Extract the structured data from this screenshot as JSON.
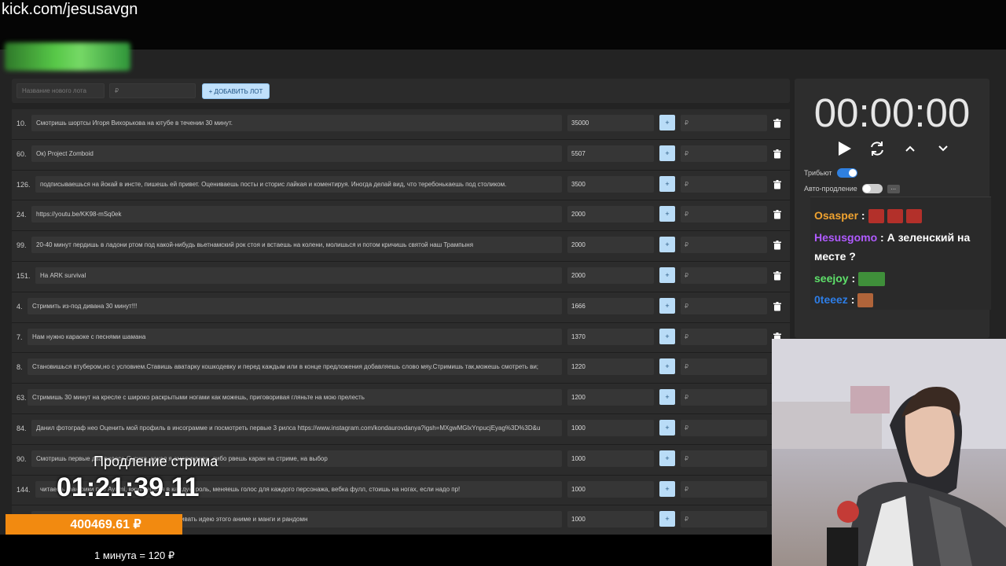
{
  "stream_url": "kick.com/jesusavgn",
  "add_lot": {
    "name_placeholder": "Название нового лота",
    "amount_placeholder": "₽",
    "button_label": "+ ДОБАВИТЬ ЛОТ"
  },
  "lots": [
    {
      "num": "10.",
      "name": "Смотришь шортсы Игоря Вихорькова на ютубе в течении 30 минут.",
      "amount": "35000"
    },
    {
      "num": "60.",
      "name": "Ок) Project Zomboid",
      "amount": "5507"
    },
    {
      "num": "126.",
      "name": "подписываешься на йокай в инсте, пишешь ей привет. Оцениваешь посты и сторис лайкая и коментируя. Иногда делай вид, что теребонькаешь под столиком.",
      "amount": "3500"
    },
    {
      "num": "24.",
      "name": "https://youtu.be/KK98-mSq0ek",
      "amount": "2000"
    },
    {
      "num": "99.",
      "name": "20-40 минут пердишь в ладони ртом под какой-нибудь вьетнамский рок стоя и встаешь на колени, молишься и потом кричишь святой наш Трампыня",
      "amount": "2000"
    },
    {
      "num": "151.",
      "name": "На ARK survival",
      "amount": "2000"
    },
    {
      "num": "4.",
      "name": "Стримить из-под дивана 30 минут!!!",
      "amount": "1666"
    },
    {
      "num": "7.",
      "name": "Нам нужно караоке с песнями шамана",
      "amount": "1370"
    },
    {
      "num": "8.",
      "name": "Становишься втубером,но с условием.Ставишь аватарку кошкодевку и перед каждым или в конце предложения добавляешь слово мяу.Стримишь так,можешь смотреть ви;",
      "amount": "1220"
    },
    {
      "num": "63.",
      "name": "Стримишь 30 минут на кресле с широко раскрытыми ногами как можешь, приговоривая гляньте на мою прелесть",
      "amount": "1200"
    },
    {
      "num": "84.",
      "name": "Данил фотограф нео Оценить мой профиль в инсограмме и посмотреть первые 3 рилса https://www.instagram.com/kondaurovdanya?igsh=MXgwMGlxYnpucjEyag%3D%3D&u",
      "amount": "1000"
    },
    {
      "num": "90.",
      "name": "Смотришь первые два видоса Сусика, какая я американец, либо рвешь каран на стриме, на выбор",
      "amount": "1000"
    },
    {
      "num": "144.",
      "name": "читаешь фанфики про Ayumi, вживаешься в каждую роль, меняешь голос для каждого персонажа, вебка фулл, стоишь на ногах, если надо пр!",
      "amount": "1000"
    },
    {
      "num": "",
      "name": "стер , обсуждаешь его с чатом и с чат гпт, нахваливать идею этого аниме и манги и рандомн",
      "amount": "1000"
    }
  ],
  "rub_placeholder": "₽",
  "timer": {
    "clock": "00:00:00",
    "tribute_label": "Трибьют",
    "auto_extend_label": "Авто-продление",
    "dots": "..."
  },
  "chat": [
    {
      "user": "Osasper",
      "sep": " :",
      "text": "",
      "color": "#f0a330"
    },
    {
      "user": "Hesusgomo",
      "sep": " :",
      "text": " А зеленский на месте ?",
      "color": "#b05bff"
    },
    {
      "user": "seejoy",
      "sep": " :",
      "text": "",
      "color": "#5ee06a"
    },
    {
      "user": "0teeez",
      "sep": " :",
      "text": "",
      "color": "#2d7de6"
    }
  ],
  "extension": {
    "label": "Продление стрима",
    "time": "01:21:39.11",
    "total": "400469.61 ₽",
    "rate": "1 минута = 120 ₽"
  },
  "colors": {
    "accent": "#f28a10",
    "button": "#b9dcf7",
    "toggle_on": "#2f80e0"
  },
  "icons": [
    "play-icon",
    "restart-icon",
    "chevron-up-icon",
    "chevron-down-icon",
    "trash-icon"
  ]
}
